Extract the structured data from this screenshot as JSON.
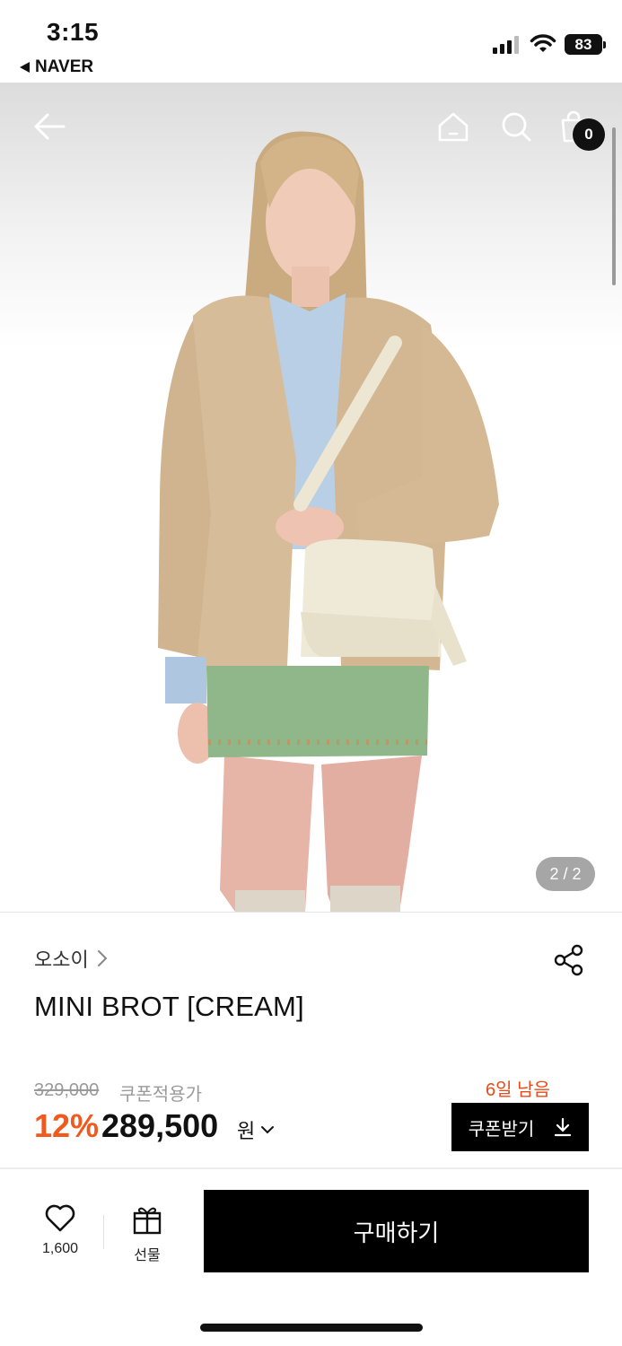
{
  "status_bar": {
    "time": "3:15",
    "back_app": "NAVER",
    "battery": "83"
  },
  "hero": {
    "pager": "2 / 2",
    "cart_count": "0"
  },
  "product": {
    "brand": "오소이",
    "title": "MINI BROT [CREAM]",
    "original_price": "329,000",
    "coupon_price_label": "쿠폰적용가",
    "days_left": "6일 남음",
    "discount": "12%",
    "price": "289,500",
    "currency": "원",
    "coupon_button": "쿠폰받기"
  },
  "actions": {
    "like_count": "1,600",
    "gift_label": "선물",
    "buy_label": "구매하기"
  },
  "colors": {
    "accent": "#f05a1e",
    "primary": "#000000"
  },
  "icons": [
    "back-arrow-icon",
    "home-icon",
    "search-icon",
    "shopping-bag-icon",
    "share-icon",
    "heart-icon",
    "gift-icon",
    "download-icon",
    "chevron-right-icon",
    "chevron-down-icon"
  ]
}
